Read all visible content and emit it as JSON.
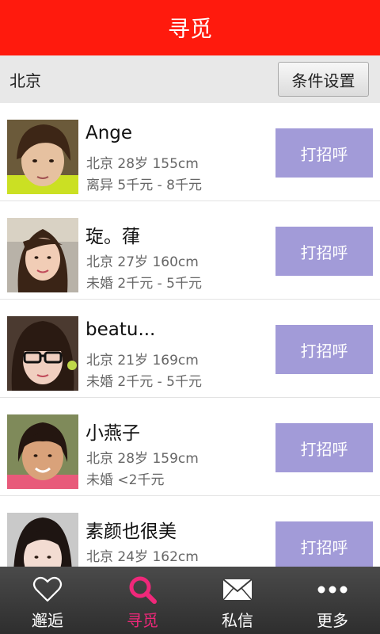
{
  "header": {
    "title": "寻觅"
  },
  "filter": {
    "city": "北京",
    "settings_label": "条件设置"
  },
  "profiles": [
    {
      "name": "Ange",
      "location_age_height": "北京 28岁 155cm",
      "status_income": "离异 5千元 - 8千元",
      "greet_label": "打招呼"
    },
    {
      "name": "琁。葎",
      "location_age_height": "北京 27岁 160cm",
      "status_income": "未婚 2千元 - 5千元",
      "greet_label": "打招呼"
    },
    {
      "name": "beatu...",
      "location_age_height": "北京 21岁 169cm",
      "status_income": "未婚 2千元 - 5千元",
      "greet_label": "打招呼"
    },
    {
      "name": "小燕子",
      "location_age_height": "北京 28岁 159cm",
      "status_income": "未婚 <2千元",
      "greet_label": "打招呼"
    },
    {
      "name": "素颜也很美",
      "location_age_height": "北京 24岁 162cm",
      "status_income": "",
      "greet_label": "打招呼"
    }
  ],
  "tabs": [
    {
      "label": "邂逅",
      "icon": "heart-icon",
      "active": false
    },
    {
      "label": "寻觅",
      "icon": "search-icon",
      "active": true
    },
    {
      "label": "私信",
      "icon": "mail-icon",
      "active": false
    },
    {
      "label": "更多",
      "icon": "more-icon",
      "active": false
    }
  ],
  "colors": {
    "header_bg": "#ff1a0d",
    "greet_button": "#a29bd8",
    "tab_active": "#f0287a",
    "tabbar_bg": "#3a3a3a"
  }
}
